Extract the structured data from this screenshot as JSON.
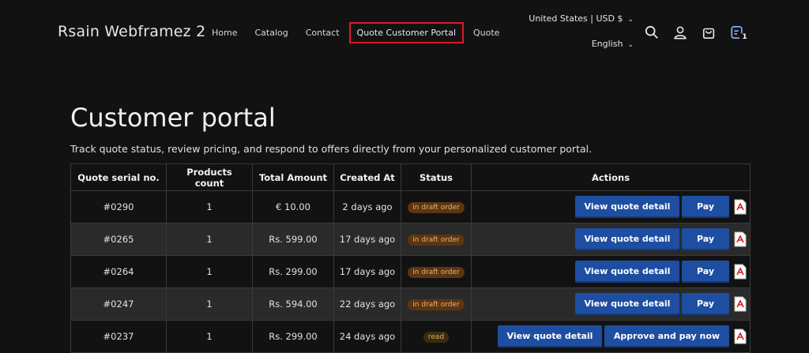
{
  "brand": "Rsain Webframez 2",
  "nav": {
    "items": [
      "Home",
      "Catalog",
      "Contact",
      "Quote Customer Portal",
      "Quote"
    ],
    "active": "Quote Customer Portal"
  },
  "locale": {
    "region": "United States | USD $",
    "language": "English"
  },
  "cart": {
    "count": "1"
  },
  "page": {
    "title": "Customer portal",
    "subtitle": "Track quote status, review pricing, and respond to offers directly from your personalized customer portal."
  },
  "table": {
    "headers": [
      "Quote serial no.",
      "Products count",
      "Total Amount",
      "Created At",
      "Status",
      "Actions"
    ],
    "rows": [
      {
        "serial": "#0290",
        "count": "1",
        "amount": "€ 10.00",
        "created": "2 days ago",
        "status": "in draft order",
        "primary": "View quote detail",
        "secondary": "Pay"
      },
      {
        "serial": "#0265",
        "count": "1",
        "amount": "Rs. 599.00",
        "created": "17 days ago",
        "status": "in draft order",
        "primary": "View quote detail",
        "secondary": "Pay"
      },
      {
        "serial": "#0264",
        "count": "1",
        "amount": "Rs. 299.00",
        "created": "17 days ago",
        "status": "in draft order",
        "primary": "View quote detail",
        "secondary": "Pay"
      },
      {
        "serial": "#0247",
        "count": "1",
        "amount": "Rs. 594.00",
        "created": "22 days ago",
        "status": "in draft order",
        "primary": "View quote detail",
        "secondary": "Pay"
      },
      {
        "serial": "#0237",
        "count": "1",
        "amount": "Rs. 299.00",
        "created": "24 days ago",
        "status": "read",
        "primary": "View quote detail",
        "secondary": "Approve and pay now"
      }
    ]
  },
  "colors": {
    "accent": "#1e4ea1",
    "active_outline": "#e0182a",
    "background": "#121212"
  },
  "icons": [
    "search-icon",
    "account-icon",
    "cart-icon",
    "quote-list-icon",
    "pdf-icon"
  ]
}
